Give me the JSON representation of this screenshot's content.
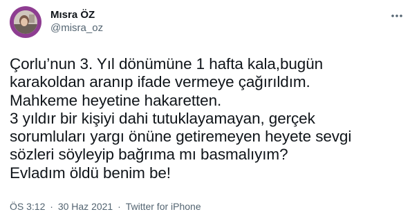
{
  "author": {
    "display_name": "Mısra ÖZ",
    "handle": "@misra_oz",
    "avatar_icon": "profile-photo-icon"
  },
  "tweet": {
    "text": "Çorlu’nun 3. Yıl dönümüne 1 hafta kala,bugün\nkarakoldan aranıp ifade vermeye çağırıldım.\nMahkeme heyetine hakaretten.\n3 yıldır bir kişiyi dahi tutuklayamayan, gerçek\nsorumluları yargı önüne getiremeyen heyete sevgi\nsözleri söyleyip bağrıma mı basmalıyım?\nEvladım öldü benim be!"
  },
  "meta": {
    "time": "ÖS 3:12",
    "separator": "·",
    "date": "30 Haz 2021",
    "source": "Twitter for iPhone"
  },
  "colors": {
    "text_primary": "#0f1419",
    "text_secondary": "#536471",
    "avatar_ring": "#8e3d91"
  }
}
